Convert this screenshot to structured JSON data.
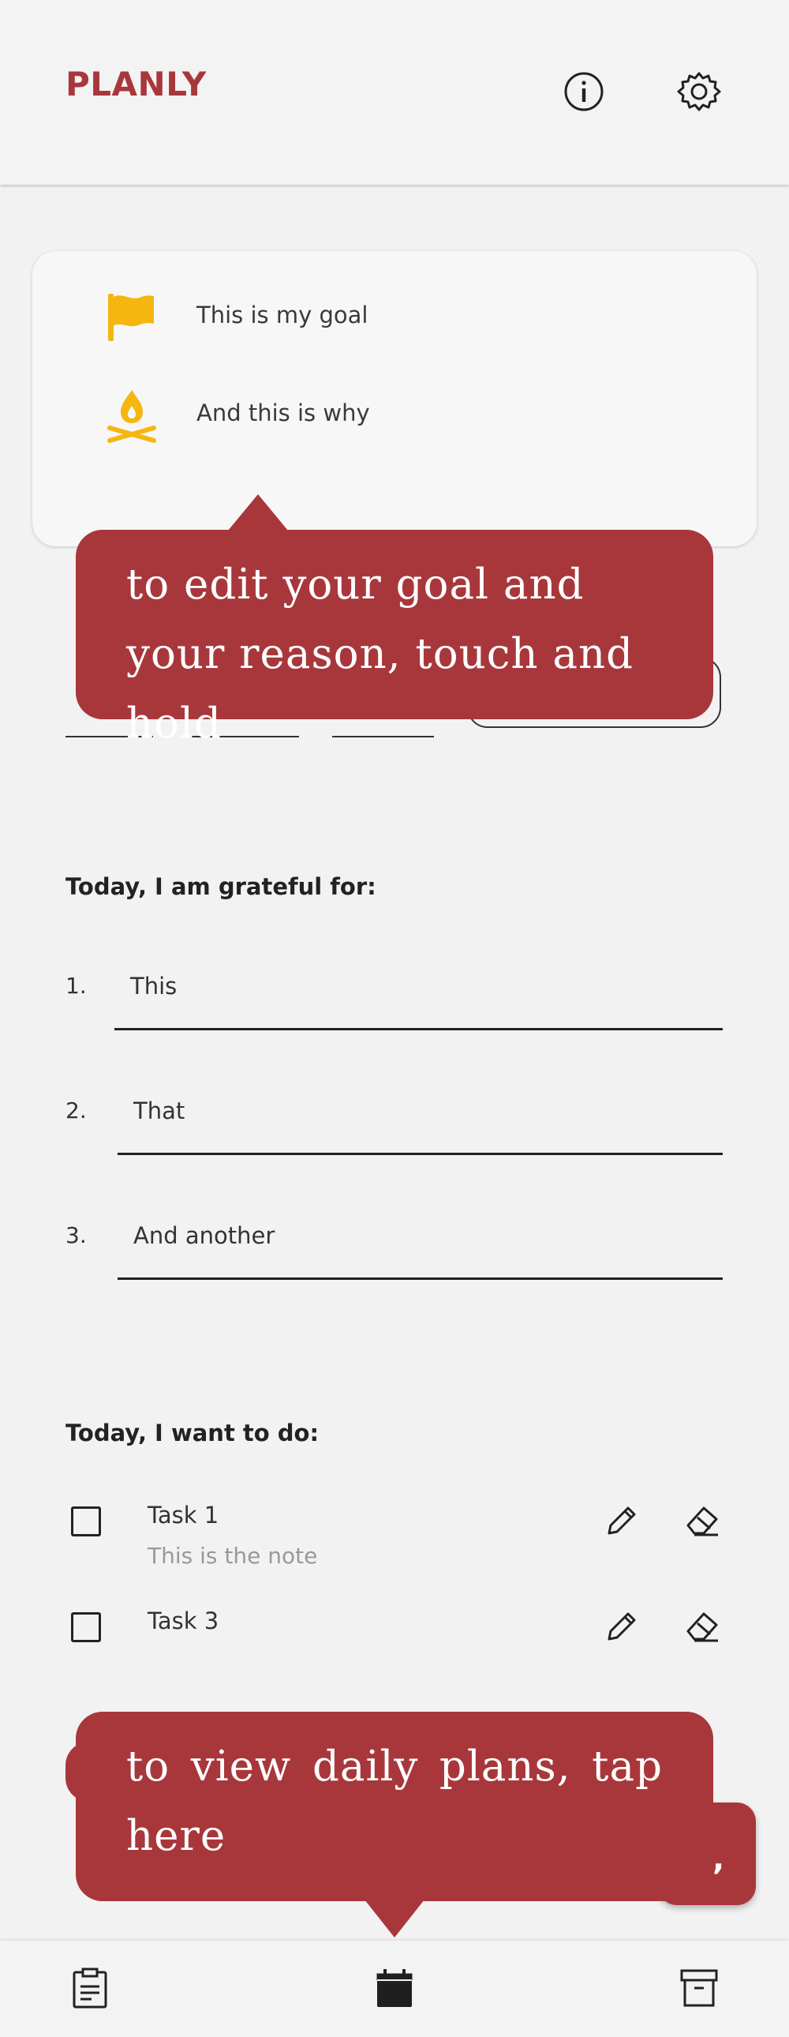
{
  "app": {
    "title": "PLANLY",
    "brand_color": "#a8373c",
    "accent_yellow": "#f5b60f"
  },
  "header": {
    "icons": [
      "info-icon",
      "gear-icon"
    ]
  },
  "goal_card": {
    "goal_text": "This is my goal",
    "reason_text": "And this is why",
    "icons": [
      "flag-icon",
      "campfire-icon"
    ]
  },
  "tooltips": {
    "goal_hint": "to edit your goal and your reason, touch and hold",
    "plans_hint": "to view daily plans, tap here"
  },
  "gratitude": {
    "title": "Today, I am grateful for:",
    "items": [
      {
        "num": "1.",
        "text": "This"
      },
      {
        "num": "2.",
        "text": "That"
      },
      {
        "num": "3.",
        "text": "And another"
      }
    ]
  },
  "todo": {
    "title": "Today, I want to do:",
    "tasks": [
      {
        "title": "Task 1",
        "note": "This is the note"
      },
      {
        "title": "Task 3",
        "note": ""
      }
    ]
  },
  "bottom_nav": {
    "items": [
      "clipboard-icon",
      "calendar-icon",
      "archive-icon"
    ]
  }
}
